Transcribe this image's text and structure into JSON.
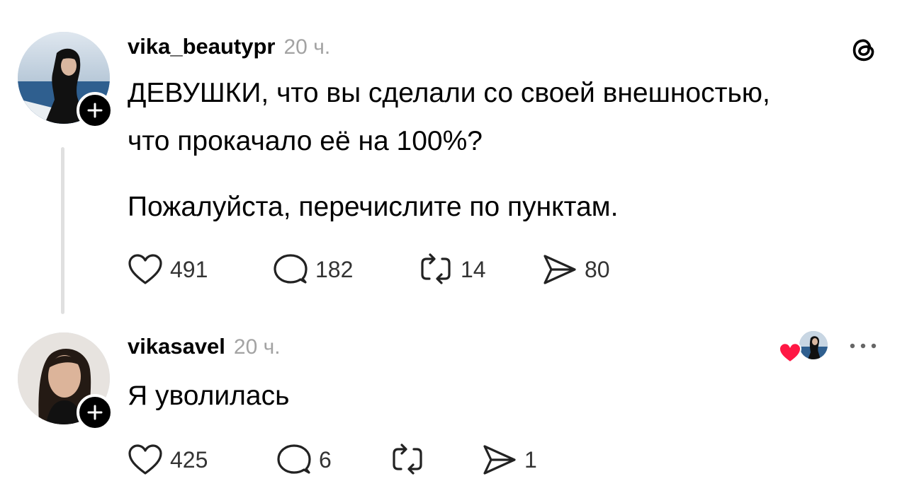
{
  "post": {
    "username": "vika_beautypr",
    "time": "20 ч.",
    "text_line1": "ДЕВУШКИ, что вы сделали со своей внешностью,",
    "text_line2": "что прокачало её на 100%?",
    "text_line3": "Пожалуйста, перечислите по пунктам.",
    "likes": "491",
    "comments": "182",
    "reposts": "14",
    "shares": "80"
  },
  "reply": {
    "username": "vikasavel",
    "time": "20 ч.",
    "text": "Я уволилась",
    "likes": "425",
    "comments": "6",
    "reposts": "",
    "shares": "1"
  },
  "icons": {
    "brand": "threads-logo-icon",
    "like": "heart-outline-icon",
    "comment": "speech-bubble-icon",
    "repost": "repost-arrows-icon",
    "share": "send-icon",
    "more": "more-dots-icon",
    "liked_by_author": "red-heart-icon"
  },
  "colors": {
    "text": "#000000",
    "muted": "#a3a3a3",
    "heart": "#ff1744"
  }
}
